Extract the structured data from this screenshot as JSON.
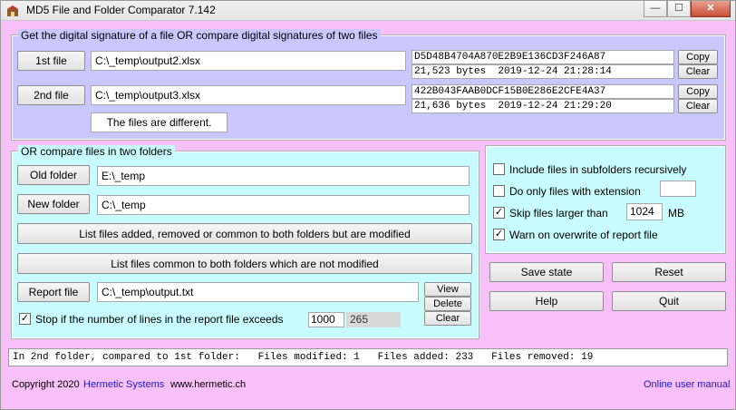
{
  "window": {
    "title": "MD5 File and Folder Comparator 7.142",
    "controls": {
      "minimize": "—",
      "maximize": "☐",
      "close": "✕"
    }
  },
  "files_section": {
    "title": "Get the digital signature of a file OR compare digital signatures of two files",
    "file1": {
      "button": "1st file",
      "path": "C:\\_temp\\output2.xlsx",
      "md5": "D5D48B4704A870E2B9E136CD3F246A87",
      "info": "21,523 bytes  2019-12-24 21:28:14",
      "copy": "Copy",
      "clear": "Clear"
    },
    "file2": {
      "button": "2nd file",
      "path": "C:\\_temp\\output3.xlsx",
      "md5": "422B043FAAB0DCF15B0E286E2CFE4A37",
      "info": "21,636 bytes  2019-12-24 21:29:20",
      "copy": "Copy",
      "clear": "Clear"
    },
    "result": "The files are different."
  },
  "folders_section": {
    "title": "OR compare files in two folders",
    "old_folder_button": "Old folder",
    "old_folder_path": "E:\\_temp",
    "new_folder_button": "New folder",
    "new_folder_path": "C:\\_temp",
    "list_modified_button": "List files added, removed or common to both folders but are modified",
    "list_unmodified_button": "List files common to both folders which are not modified",
    "report_button": "Report file",
    "report_path": "C:\\_temp\\output.txt",
    "view": "View",
    "delete": "Delete",
    "clear": "Clear",
    "stop_label": "Stop if the number of lines in the report file exceeds",
    "stop_checked": true,
    "stop_value": "1000",
    "line_count": "265"
  },
  "options": {
    "subfolders": {
      "label": "Include files in subfolders recursively",
      "checked": false
    },
    "extension": {
      "label": "Do only files with extension",
      "checked": false,
      "value": ""
    },
    "skip_larger": {
      "label": "Skip files larger than",
      "checked": true,
      "value": "1024",
      "unit": "MB"
    },
    "warn_overwrite": {
      "label": "Warn on overwrite of report file",
      "checked": true
    }
  },
  "actions": {
    "save_state": "Save state",
    "reset": "Reset",
    "help": "Help",
    "quit": "Quit"
  },
  "status_text": "In 2nd folder, compared to 1st folder:   Files modified: 1   Files added: 233   Files removed: 19",
  "footer": {
    "copyright": "Copyright 2020",
    "company": "Hermetic Systems",
    "website": "www.hermetic.ch",
    "manual": "Online user manual"
  },
  "colors": {
    "background": "#f8c0f8",
    "files_group": "#c8c8ff",
    "folders_group": "#c8fcfc",
    "link": "#1a1ac8"
  }
}
